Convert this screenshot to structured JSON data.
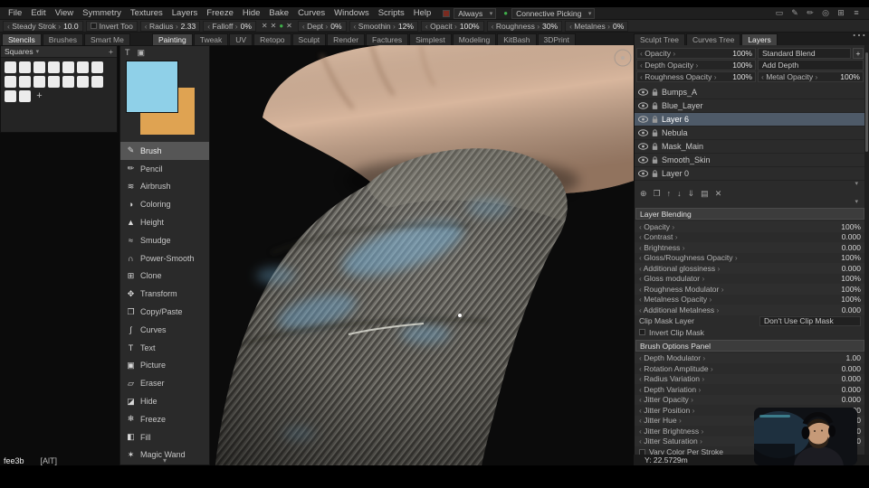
{
  "menubar": {
    "items": [
      "File",
      "Edit",
      "View",
      "Symmetry",
      "Textures",
      "Layers",
      "Freeze",
      "Hide",
      "Bake",
      "Curves",
      "Windows",
      "Scripts",
      "Help"
    ],
    "always_dropdown": "Always",
    "picking_dropdown": "Connective Picking"
  },
  "menubar_icons": [
    {
      "name": "display",
      "glyph": "▭"
    },
    {
      "name": "pen",
      "glyph": "✎"
    },
    {
      "name": "pencil",
      "glyph": "✏"
    },
    {
      "name": "picker",
      "glyph": "◎"
    },
    {
      "name": "layout",
      "glyph": "⊞"
    },
    {
      "name": "menu",
      "glyph": "≡"
    }
  ],
  "toolbar": {
    "stroke_mode": {
      "label": "Steady Strok",
      "value": "10.0"
    },
    "invert_label": "Invert Too",
    "radius": {
      "label": "Radius",
      "value": "2.33"
    },
    "falloff": {
      "label": "Falloff",
      "value": "0%"
    },
    "depth": {
      "label": "Dept",
      "value": "0%"
    },
    "smoothing": {
      "label": "Smoothin",
      "value": "12%"
    },
    "opacity": {
      "label": "Opacit",
      "value": "100%"
    },
    "roughness": {
      "label": "Roughness",
      "value": "30%"
    },
    "metalness": {
      "label": "Metalnes",
      "value": "0%"
    }
  },
  "left_tabs": [
    "Stencils",
    "Brushes",
    "Smart Me"
  ],
  "active_left_tab": "Stencils",
  "workspace_tabs": [
    "Painting",
    "Tweak",
    "UV",
    "Retopo",
    "Sculpt",
    "Render",
    "Factures",
    "Simplest",
    "Modeling",
    "KitBash",
    "3DPrint"
  ],
  "active_workspace_tab": "Painting",
  "right_tabs": [
    "Sculpt Tree",
    "Curves Tree",
    "Layers"
  ],
  "active_right_tab": "Layers",
  "stencils": {
    "title": "Squares",
    "count": 16
  },
  "tools": [
    "Brush",
    "Pencil",
    "Airbrush",
    "Coloring",
    "Height",
    "Smudge",
    "Power-Smooth",
    "Clone",
    "Transform",
    "Copy/Paste",
    "Curves",
    "Text",
    "Picture",
    "Eraser",
    "Hide",
    "Freeze",
    "Fill",
    "Magic Wand"
  ],
  "active_tool": "Brush",
  "color_picker": {
    "primary": "#8fd0e8",
    "secondary": "#dfa352"
  },
  "layers_panel": {
    "opacity": {
      "label": "Opacity",
      "value": "100%"
    },
    "blend": "Standard Blend",
    "depth_opacity": {
      "label": "Depth Opacity",
      "value": "100%"
    },
    "depth_blend": "Add Depth",
    "roughness_opacity": {
      "label": "Roughness Opacity",
      "value": "100%"
    },
    "metal_opacity": {
      "label": "Metal Opacity",
      "value": "100%"
    },
    "layers": [
      {
        "name": "Bumps_A",
        "selected": false
      },
      {
        "name": "Blue_Layer",
        "selected": false
      },
      {
        "name": "Layer 6",
        "selected": true
      },
      {
        "name": "Nebula",
        "selected": false
      },
      {
        "name": "Mask_Main",
        "selected": false
      },
      {
        "name": "Smooth_Skin",
        "selected": false
      },
      {
        "name": "Layer 0",
        "selected": false
      }
    ]
  },
  "layer_toolbar_icons": [
    {
      "name": "new-layer",
      "glyph": "⊕"
    },
    {
      "name": "duplicate-layer",
      "glyph": "❐"
    },
    {
      "name": "move-layer-up",
      "glyph": "↑"
    },
    {
      "name": "move-layer-down",
      "glyph": "↓"
    },
    {
      "name": "merge-down",
      "glyph": "⇓"
    },
    {
      "name": "layer-folder",
      "glyph": "▤"
    },
    {
      "name": "delete-layer",
      "glyph": "✕"
    }
  ],
  "layer_blending": {
    "title": "Layer Blending",
    "rows": [
      {
        "label": "Opacity",
        "value": "100%"
      },
      {
        "label": "Contrast",
        "value": "0.000"
      },
      {
        "label": "Brightness",
        "value": "0.000"
      },
      {
        "label": "Gloss/Roughness Opacity",
        "value": "100%"
      },
      {
        "label": "Additional glossiness",
        "value": "0.000"
      },
      {
        "label": "Gloss modulator",
        "value": "100%"
      },
      {
        "label": "Roughness Modulator",
        "value": "100%"
      },
      {
        "label": "Metalness Opacity",
        "value": "100%"
      },
      {
        "label": "Additional Metalness",
        "value": "0.000"
      }
    ],
    "clip_mask_label": "Clip Mask Layer",
    "clip_mask_value": "Don't Use Clip Mask",
    "invert_clip": "Invert Clip Mask"
  },
  "brush_options": {
    "title": "Brush Options Panel",
    "rows": [
      {
        "label": "Depth Modulator",
        "value": "1.00"
      },
      {
        "label": "Rotation Amplitude",
        "value": "0.000"
      },
      {
        "label": "Radius Variation",
        "value": "0.000"
      },
      {
        "label": "Depth Variation",
        "value": "0.000"
      },
      {
        "label": "Jitter Opacity",
        "value": "0.000"
      },
      {
        "label": "Jitter Position",
        "value": "0.000"
      },
      {
        "label": "Jitter Hue",
        "value": "0.000"
      },
      {
        "label": "Jitter Brightness",
        "value": "0.000"
      },
      {
        "label": "Jitter Saturation",
        "value": "0.000"
      }
    ],
    "vary_color": "Vary Color Per Stroke"
  },
  "status": {
    "left": "fee3b",
    "shortcut": "[AlT]",
    "coords": "Y: 22.5729m"
  },
  "icons": {
    "cross": "✕",
    "green_dot": "●",
    "plus": "+",
    "caret_down": "▾",
    "ellipsis": "⋯",
    "text_tool": "T",
    "panel": "▣"
  }
}
